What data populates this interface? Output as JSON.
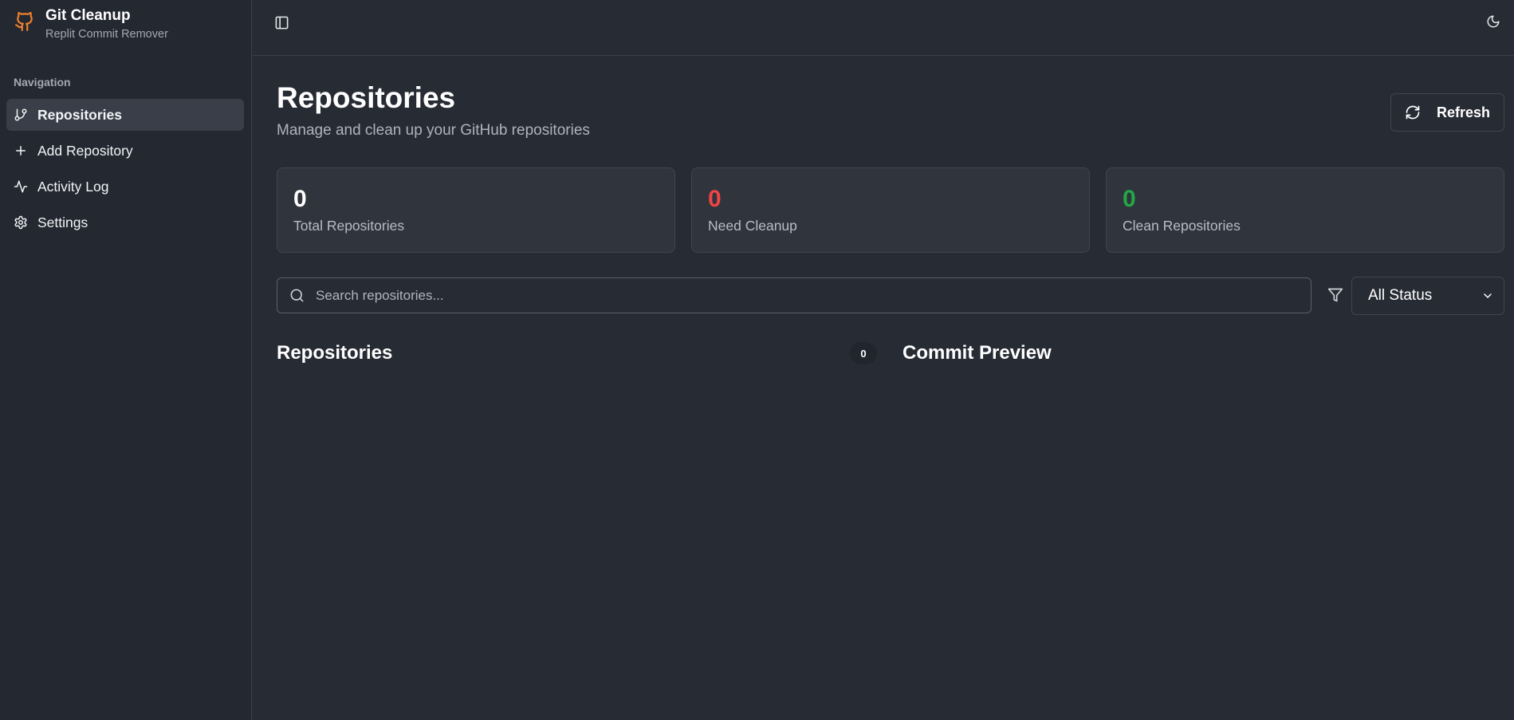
{
  "app": {
    "title": "Git Cleanup",
    "subtitle": "Replit Commit Remover",
    "brand_color": "#f0822e",
    "logo_icon": "github-icon"
  },
  "sidebar": {
    "nav_label": "Navigation",
    "items": [
      {
        "label": "Repositories",
        "icon": "git-branch-icon",
        "active": true
      },
      {
        "label": "Add Repository",
        "icon": "plus-icon",
        "active": false
      },
      {
        "label": "Activity Log",
        "icon": "activity-icon",
        "active": false
      },
      {
        "label": "Settings",
        "icon": "gear-icon",
        "active": false
      }
    ]
  },
  "topbar": {
    "sidebar_toggle_icon": "panel-left-icon",
    "theme_toggle_icon": "moon-icon"
  },
  "page": {
    "title": "Repositories",
    "subtitle": "Manage and clean up your GitHub repositories",
    "refresh_label": "Refresh",
    "refresh_icon": "refresh-icon"
  },
  "stats": [
    {
      "value": "0",
      "label": "Total Repositories",
      "color": "#ffffff"
    },
    {
      "value": "0",
      "label": "Need Cleanup",
      "color": "#ef4444"
    },
    {
      "value": "0",
      "label": "Clean Repositories",
      "color": "#22a846"
    }
  ],
  "search": {
    "placeholder": "Search repositories...",
    "value": "",
    "icon": "search-icon"
  },
  "filter": {
    "icon": "filter-icon",
    "selected": "All Status"
  },
  "repositories_panel": {
    "title": "Repositories",
    "count": "0"
  },
  "preview_panel": {
    "title": "Commit Preview"
  }
}
